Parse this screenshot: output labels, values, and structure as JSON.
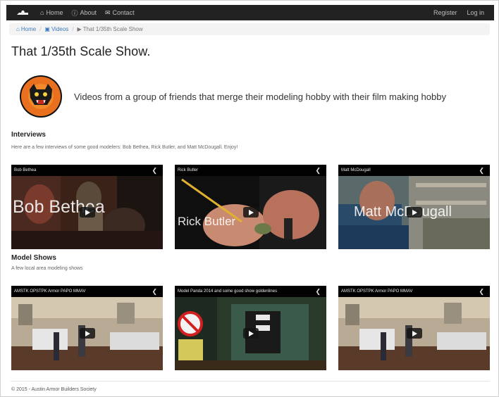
{
  "nav": {
    "items": [
      {
        "icon": "home-icon",
        "glyph": "⌂",
        "label": "Home"
      },
      {
        "icon": "info-icon",
        "glyph": "ⓘ",
        "label": "About"
      },
      {
        "icon": "mail-icon",
        "glyph": "✉",
        "label": "Contact"
      }
    ],
    "register": "Register",
    "login": "Log in"
  },
  "breadcrumb": {
    "home": "Home",
    "videos": "Videos",
    "current": "That 1/35th Scale Show"
  },
  "page": {
    "title": "That 1/35th Scale Show.",
    "hero_text": "Videos from a group of friends that merge their modeling hobby with their film making hobby"
  },
  "interviews": {
    "title": "Interviews",
    "description": "Here are a few interviews of some good modelers: Bob Bethea, Rick Butler, and Matt McDougall. Enjoy!",
    "videos": [
      {
        "bar_title": "Bob Bethea",
        "overlay": "Bob Bethea"
      },
      {
        "bar_title": "Rick Butler",
        "overlay": "Rick Butler"
      },
      {
        "bar_title": "Matt McDougall",
        "overlay": "Matt McDougall"
      }
    ]
  },
  "model_shows": {
    "title": "Model Shows",
    "description": "A few local area modeling shows",
    "videos": [
      {
        "bar_title": "AMSTK OPSTPK Armor PAPO MMAV"
      },
      {
        "bar_title": "Model Panda 2014 and some good show goldenlines"
      },
      {
        "bar_title": "AMSTK OPSTPK Armor PAPO MMAV"
      }
    ]
  },
  "footer": {
    "text": "© 2015 - Austin Armor Builders Society"
  },
  "colors": {
    "navbar": "#222222",
    "link": "#3a7bbf",
    "logo_orange": "#e8701e"
  }
}
